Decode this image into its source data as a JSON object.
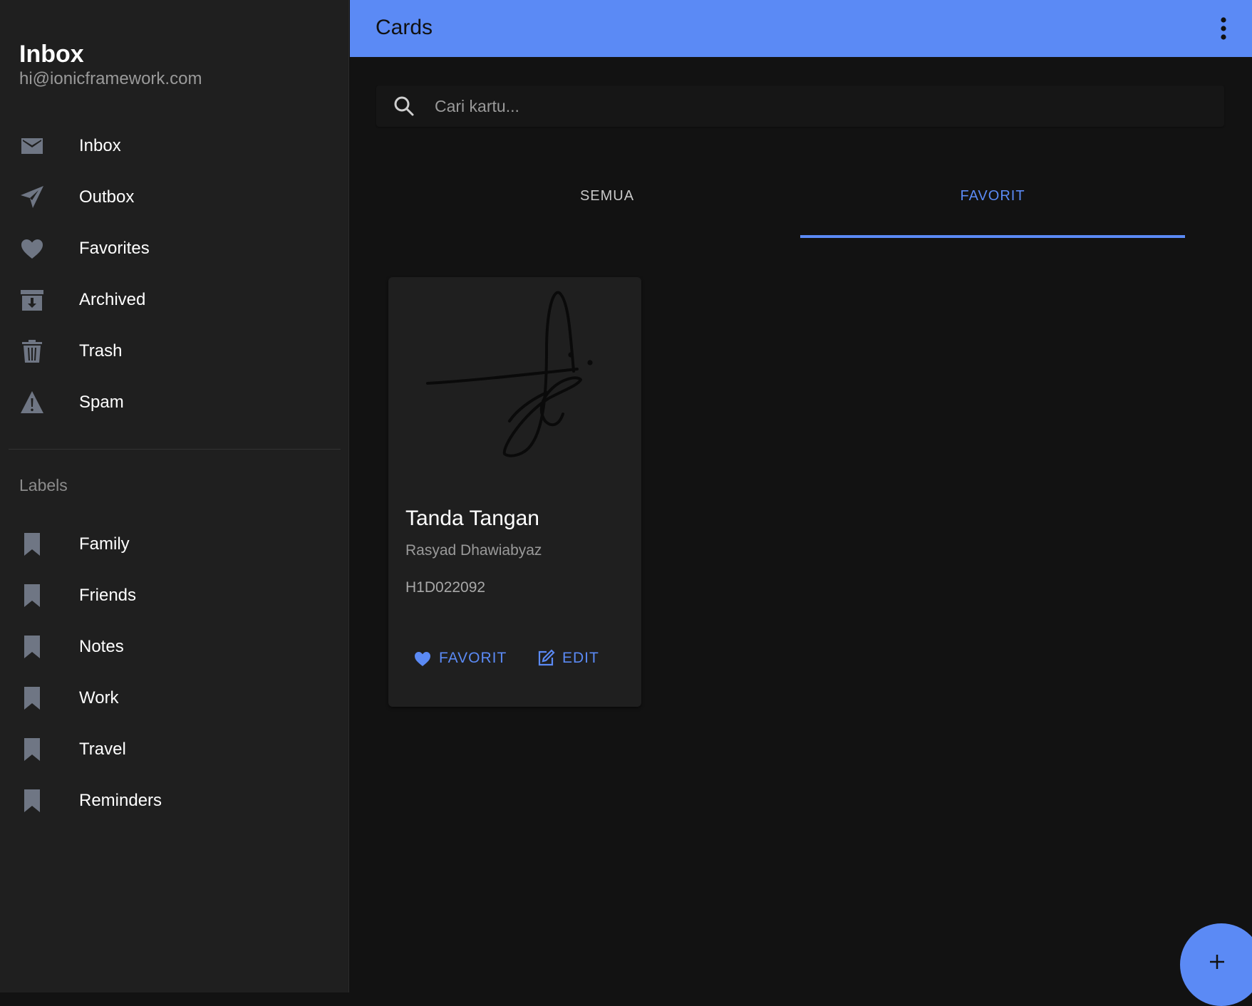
{
  "sidebar": {
    "title": "Inbox",
    "email": "hi@ionicframework.com",
    "items": [
      {
        "label": "Inbox",
        "icon": "mail-icon"
      },
      {
        "label": "Outbox",
        "icon": "paper-plane-icon"
      },
      {
        "label": "Favorites",
        "icon": "heart-icon"
      },
      {
        "label": "Archived",
        "icon": "archive-icon"
      },
      {
        "label": "Trash",
        "icon": "trash-icon"
      },
      {
        "label": "Spam",
        "icon": "warning-icon"
      }
    ],
    "labels_heading": "Labels",
    "labels": [
      {
        "label": "Family",
        "icon": "bookmark-icon"
      },
      {
        "label": "Friends",
        "icon": "bookmark-icon"
      },
      {
        "label": "Notes",
        "icon": "bookmark-icon"
      },
      {
        "label": "Work",
        "icon": "bookmark-icon"
      },
      {
        "label": "Travel",
        "icon": "bookmark-icon"
      },
      {
        "label": "Reminders",
        "icon": "bookmark-icon"
      }
    ]
  },
  "toolbar": {
    "title": "Cards",
    "menu_icon": "ellipsis-vertical-icon"
  },
  "search": {
    "placeholder": "Cari kartu...",
    "value": ""
  },
  "tabs": [
    {
      "label": "SEMUA",
      "active": false
    },
    {
      "label": "FAVORIT",
      "active": true
    }
  ],
  "cards": [
    {
      "title": "Tanda Tangan",
      "subtitle": "Rasyad Dhawiabyaz",
      "code": "H1D022092",
      "favorite_label": "FAVORIT",
      "edit_label": "EDIT"
    }
  ],
  "colors": {
    "accent": "#5b8af5",
    "sidebar_bg": "#1f1f1f",
    "content_bg": "#121212",
    "icon": "#6f7684"
  },
  "fab": {
    "icon": "add-icon"
  }
}
